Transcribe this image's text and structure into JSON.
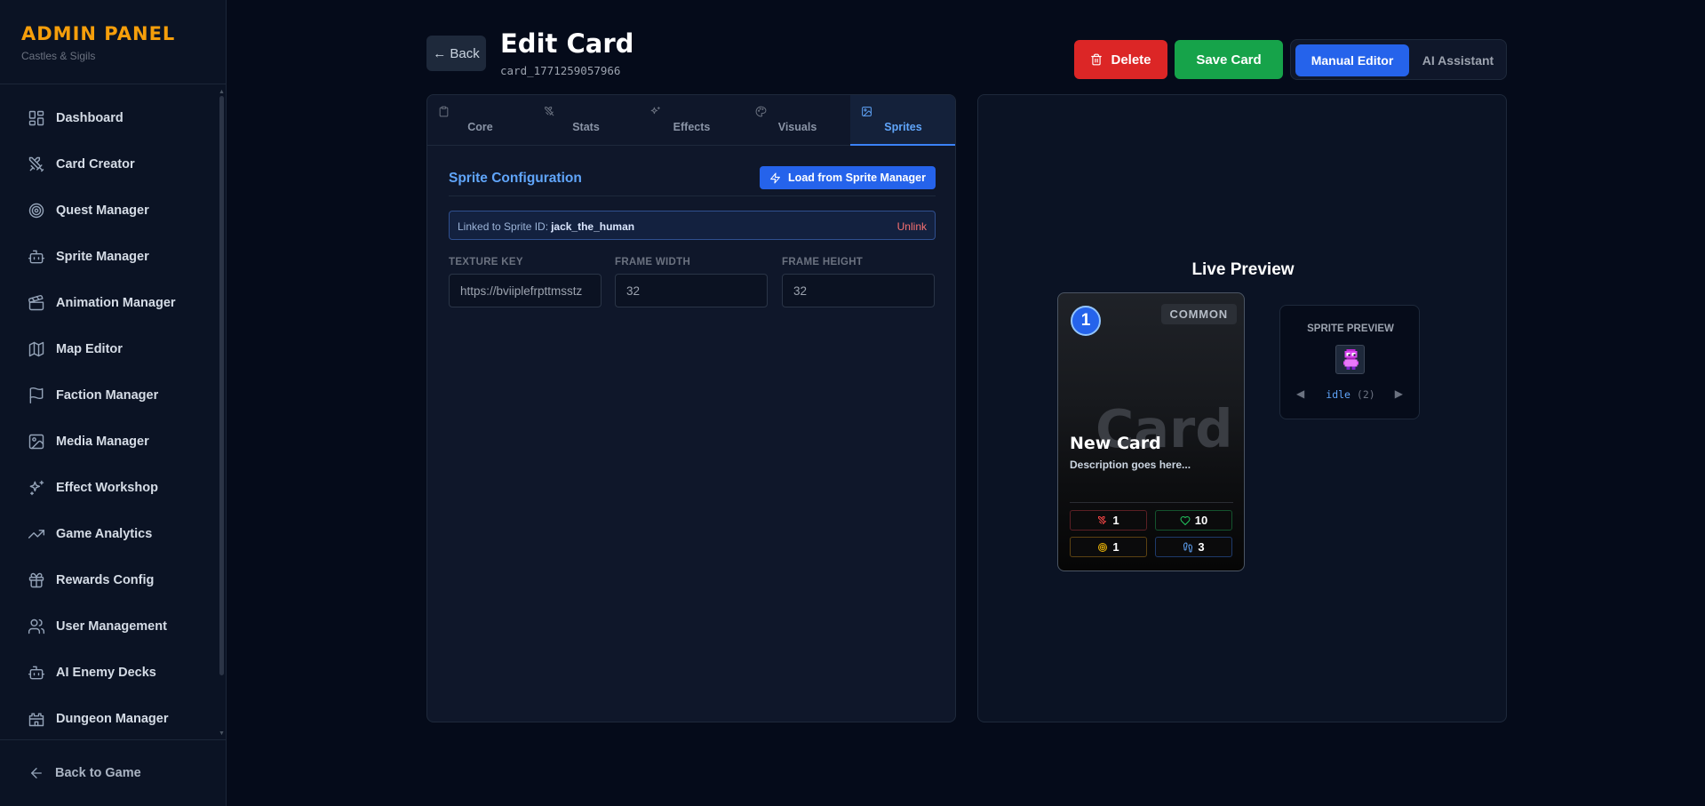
{
  "sidebar": {
    "brand": "ADMIN PANEL",
    "subtitle": "Castles & Sigils",
    "items": [
      {
        "label": "Dashboard",
        "icon": "dashboard-icon"
      },
      {
        "label": "Card Creator",
        "icon": "swords-icon"
      },
      {
        "label": "Quest Manager",
        "icon": "target-icon"
      },
      {
        "label": "Sprite Manager",
        "icon": "bot-icon"
      },
      {
        "label": "Animation Manager",
        "icon": "clapperboard-icon"
      },
      {
        "label": "Map Editor",
        "icon": "map-icon"
      },
      {
        "label": "Faction Manager",
        "icon": "flag-icon"
      },
      {
        "label": "Media Manager",
        "icon": "image-icon"
      },
      {
        "label": "Effect Workshop",
        "icon": "sparkles-icon"
      },
      {
        "label": "Game Analytics",
        "icon": "trending-up-icon"
      },
      {
        "label": "Rewards Config",
        "icon": "gift-icon"
      },
      {
        "label": "User Management",
        "icon": "users-icon"
      },
      {
        "label": "AI Enemy Decks",
        "icon": "bot-icon"
      },
      {
        "label": "Dungeon Manager",
        "icon": "castle-icon"
      }
    ],
    "footer": "Back to Game"
  },
  "header": {
    "back": "← Back",
    "title": "Edit Card",
    "card_id": "card_1771259057966",
    "delete": "Delete",
    "save": "Save Card",
    "mode_manual": "Manual Editor",
    "mode_ai": "AI Assistant"
  },
  "tabs": [
    {
      "label": "Core",
      "icon": "clipboard-icon"
    },
    {
      "label": "Stats",
      "icon": "swords-icon"
    },
    {
      "label": "Effects",
      "icon": "sparkles-icon"
    },
    {
      "label": "Visuals",
      "icon": "palette-icon"
    },
    {
      "label": "Sprites",
      "icon": "image-icon",
      "active": true
    }
  ],
  "sprites": {
    "section_title": "Sprite Configuration",
    "load_button": "Load from Sprite Manager",
    "linked_prefix": "Linked to Sprite ID:",
    "linked_id": "jack_the_human",
    "unlink": "Unlink",
    "texture_key_label": "TEXTURE KEY",
    "texture_key_value": "https://bviiplefrpttmsstz",
    "frame_width_label": "FRAME WIDTH",
    "frame_width_value": "32",
    "frame_height_label": "FRAME HEIGHT",
    "frame_height_value": "32"
  },
  "preview": {
    "title": "Live Preview",
    "card": {
      "cost": "1",
      "rarity": "COMMON",
      "watermark": "Card",
      "name": "New Card",
      "description": "Description goes here...",
      "attack": "1",
      "health": "10",
      "range": "1",
      "movement": "3"
    },
    "sprite": {
      "label": "SPRITE PREVIEW",
      "prev": "◀",
      "next": "▶",
      "animation": "idle",
      "frames": "(2)"
    }
  },
  "colors": {
    "accent": "#2563eb",
    "brand": "#f59e0b",
    "delete": "#dc2626",
    "save": "#16a34a",
    "attack": "#ef4444",
    "health": "#22c55e",
    "range": "#eab308",
    "movement": "#60a5fa"
  }
}
